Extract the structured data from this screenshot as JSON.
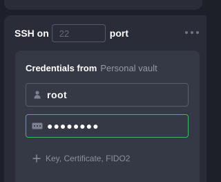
{
  "host_config": {
    "ssh_label": "SSH on",
    "port_placeholder": "22",
    "port_value": "",
    "port_label": "port",
    "menu_icon": "more-horizontal-icon"
  },
  "credentials": {
    "title": "Credentials from",
    "vault": "Personal vault",
    "username": {
      "icon": "user-icon",
      "value": "root"
    },
    "password": {
      "icon": "password-icon",
      "masked_value": "●●●●●●●●"
    },
    "add_option": {
      "icon": "plus-icon",
      "label": "Key, Certificate, FIDO2"
    }
  },
  "colors": {
    "background": "#1e2029",
    "panel": "#2a2d38",
    "card": "#353845",
    "focus_border": "#3fb86a",
    "muted_text": "#9599a6"
  }
}
